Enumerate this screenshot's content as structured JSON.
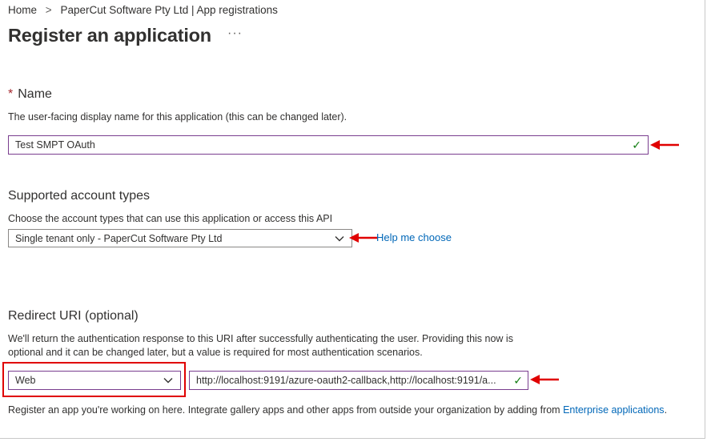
{
  "breadcrumb": {
    "items": [
      "Home",
      "PaperCut Software Pty Ltd | App registrations"
    ],
    "separator": ">"
  },
  "page": {
    "title": "Register an application",
    "more": "···"
  },
  "name_section": {
    "required_mark": "*",
    "label": "Name",
    "description": "The user-facing display name for this application (this can be changed later).",
    "value": "Test SMPT OAuth"
  },
  "account_types": {
    "label": "Supported account types",
    "description": "Choose the account types that can use this application or access this API",
    "selected": "Single tenant only - PaperCut Software Pty Ltd",
    "help_link": "Help me choose"
  },
  "redirect": {
    "label": "Redirect URI (optional)",
    "description_line1": "We'll return the authentication response to this URI after successfully authenticating the user. Providing this now is",
    "description_line2": "optional and it can be changed later, but a value is required for most authentication scenarios.",
    "platform": "Web",
    "uri_value": "http://localhost:9191/azure-oauth2-callback,http://localhost:9191/a..."
  },
  "footer": {
    "text": "Register an app you're working on here. Integrate gallery apps and other apps from outside your organization by adding from",
    "link": "Enterprise applications",
    "trailing": "."
  },
  "colors": {
    "accent_purple": "#7a3e8f",
    "link_blue": "#0067b8",
    "annotation_red": "#e00000",
    "success_green": "#107c10"
  }
}
